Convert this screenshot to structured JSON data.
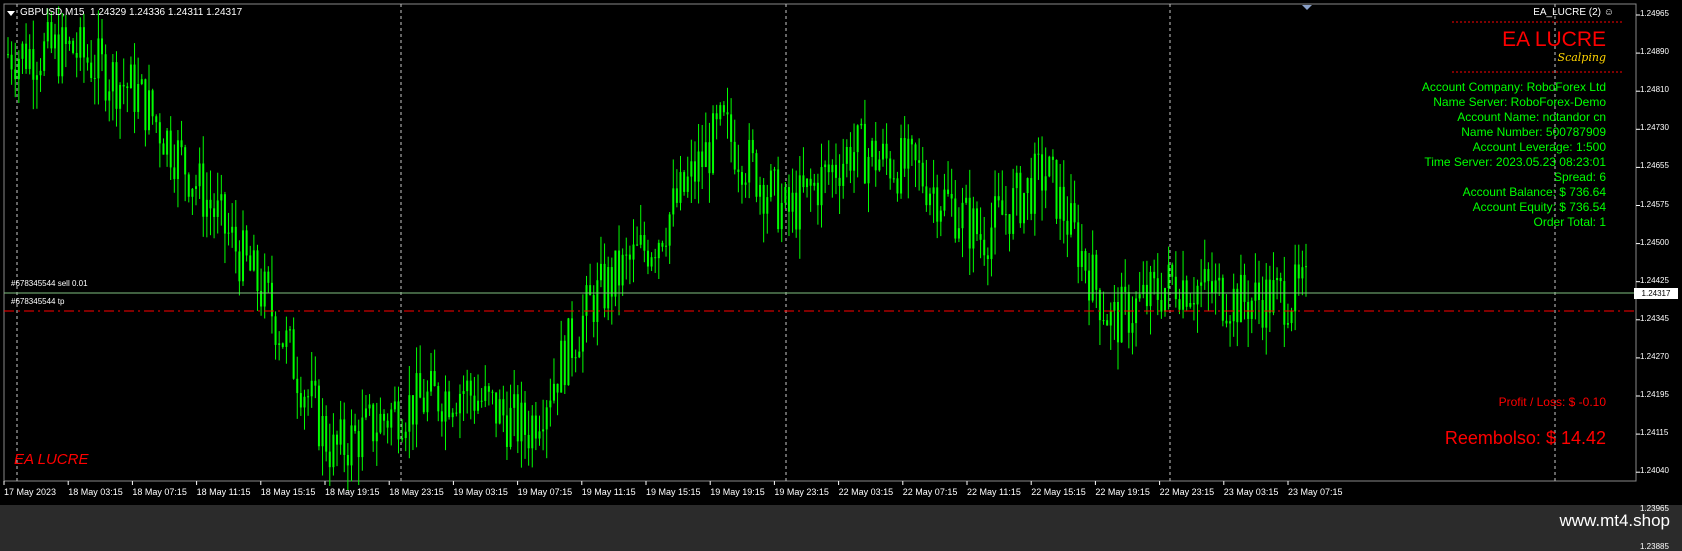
{
  "header": {
    "symbol": "GBPUSD,M15",
    "ohlc": "1.24329 1.24336 1.24311 1.24317"
  },
  "ea": {
    "tag": "EA_LUCRE (2)",
    "title": "EA LUCRE",
    "subtitle": "Scalping",
    "watermark": "EA LUCRE",
    "info": [
      "Account Company: RoboForex Ltd",
      "Name Server: RoboForex-Demo",
      "Account Name: notandor cn",
      "Name Number: 500787909",
      "Account Leverage: 1:500",
      "Time Server: 2023.05.23 08:23:01",
      "Spread: 6",
      "Account Balance: $ 736.64",
      "Account Equity: $ 736.54",
      "Order Total: 1"
    ],
    "profit_loss": "Profit / Loss: $ -0.10",
    "reembolso": "Reembolso: $ 14.42"
  },
  "orders": {
    "sell": "#678345544 sell 0.01",
    "tp": "#678345544 tp"
  },
  "price_axis": [
    "1.24965",
    "1.24890",
    "1.24810",
    "1.24730",
    "1.24655",
    "1.24575",
    "1.24500",
    "1.24425",
    "1.24345",
    "1.24270",
    "1.24195",
    "1.24115",
    "1.24040",
    "1.23965",
    "1.23885"
  ],
  "current_price": "1.24317",
  "time_axis": [
    "17 May 2023",
    "18 May 03:15",
    "18 May 07:15",
    "18 May 11:15",
    "18 May 15:15",
    "18 May 19:15",
    "18 May 23:15",
    "19 May 03:15",
    "19 May 07:15",
    "19 May 11:15",
    "19 May 15:15",
    "19 May 19:15",
    "19 May 23:15",
    "22 May 03:15",
    "22 May 07:15",
    "22 May 11:15",
    "22 May 15:15",
    "22 May 19:15",
    "22 May 23:15",
    "23 May 03:15",
    "23 May 07:15"
  ],
  "colors": {
    "background": "#000000",
    "candle": "#00ff00",
    "info": "#00ff00",
    "accent": "#ff0000",
    "sell_line": "#7fbf7f",
    "tp_line": "#ff0000",
    "grid": "#c8c8c8"
  },
  "site": "www.mt4.shop",
  "chart_data": {
    "type": "line",
    "title": "GBPUSD,M15",
    "x": [
      "17 May 2023",
      "18 May 03:15",
      "18 May 07:15",
      "18 May 11:15",
      "18 May 15:15",
      "18 May 19:15",
      "18 May 23:15",
      "19 May 03:15",
      "19 May 07:15",
      "19 May 11:15",
      "19 May 15:15",
      "19 May 19:15",
      "19 May 23:15",
      "22 May 03:15",
      "22 May 07:15",
      "22 May 11:15",
      "22 May 15:15",
      "22 May 19:15",
      "22 May 23:15",
      "23 May 03:15",
      "23 May 07:15"
    ],
    "series": [
      {
        "values": [
          1.2487,
          1.2488,
          1.2478,
          1.2455,
          1.243,
          1.2395,
          1.2405,
          1.241,
          1.24,
          1.243,
          1.2445,
          1.247,
          1.245,
          1.2465,
          1.246,
          1.2445,
          1.246,
          1.2425,
          1.2435,
          1.243,
          1.2432
        ]
      }
    ],
    "ylim": [
      1.23885,
      1.24965
    ],
    "ticks": [
      "1.24965",
      "1.24890",
      "1.24810",
      "1.24730",
      "1.24655",
      "1.24575",
      "1.24500",
      "1.24425",
      "1.24345",
      "1.24270",
      "1.24195",
      "1.24115",
      "1.24040",
      "1.23965",
      "1.23885"
    ],
    "grid": "vertical"
  }
}
